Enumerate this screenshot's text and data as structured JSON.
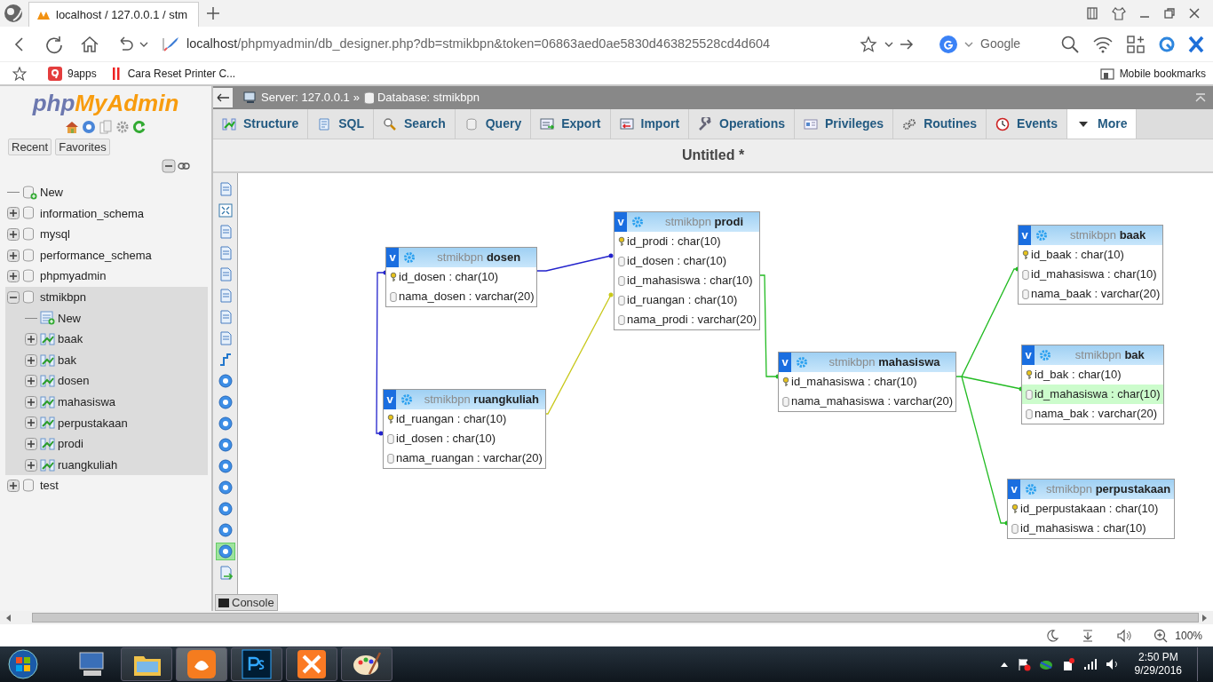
{
  "browser": {
    "tab_title": "localhost / 127.0.0.1 / stm",
    "url_host": "localhost",
    "url_path": "/phpmyadmin/db_designer.php?db=stmikbpn&token=06863aed0ae5830d463825528cd4d604",
    "search_engine": "Google",
    "bookmarks": [
      "9apps",
      "Cara Reset Printer C..."
    ],
    "mobile_bookmarks": "Mobile bookmarks"
  },
  "sidebar": {
    "logo": [
      "php",
      "MyAdmin"
    ],
    "buttons": [
      "Recent",
      "Favorites"
    ],
    "tree": [
      {
        "label": "New",
        "kind": "new"
      },
      {
        "label": "information_schema",
        "kind": "database",
        "expanded": false
      },
      {
        "label": "mysql",
        "kind": "database",
        "expanded": false
      },
      {
        "label": "performance_schema",
        "kind": "database",
        "expanded": false
      },
      {
        "label": "phpmyadmin",
        "kind": "database",
        "expanded": false
      },
      {
        "label": "stmikbpn",
        "kind": "database",
        "expanded": true,
        "children": [
          {
            "label": "New",
            "kind": "new"
          },
          {
            "label": "baak",
            "kind": "table",
            "expanded": false
          },
          {
            "label": "bak",
            "kind": "table",
            "expanded": false
          },
          {
            "label": "dosen",
            "kind": "table",
            "expanded": false
          },
          {
            "label": "mahasiswa",
            "kind": "table",
            "expanded": false
          },
          {
            "label": "perpustakaan",
            "kind": "table",
            "expanded": false
          },
          {
            "label": "prodi",
            "kind": "table",
            "expanded": false
          },
          {
            "label": "ruangkuliah",
            "kind": "table",
            "expanded": false
          }
        ]
      },
      {
        "label": "test",
        "kind": "database",
        "expanded": false
      }
    ]
  },
  "breadcrumb": {
    "server": "Server: 127.0.0.1",
    "separator": "»",
    "database": "Database: stmikbpn"
  },
  "tabs": [
    {
      "label": "Structure",
      "selected": false
    },
    {
      "label": "SQL",
      "selected": false
    },
    {
      "label": "Search",
      "selected": false
    },
    {
      "label": "Query",
      "selected": false
    },
    {
      "label": "Export",
      "selected": false
    },
    {
      "label": "Import",
      "selected": false
    },
    {
      "label": "Operations",
      "selected": false
    },
    {
      "label": "Privileges",
      "selected": false
    },
    {
      "label": "Routines",
      "selected": false
    },
    {
      "label": "Events",
      "selected": false
    },
    {
      "label": "More",
      "selected": true
    }
  ],
  "designer": {
    "title": "Untitled *",
    "console": "Console",
    "toolbar": [
      {
        "active": false
      },
      {
        "active": false
      },
      {
        "active": false
      },
      {
        "active": false
      },
      {
        "active": false
      },
      {
        "active": false
      },
      {
        "active": false
      },
      {
        "active": false
      },
      {
        "active": false
      },
      {
        "active": false
      },
      {
        "active": false
      },
      {
        "active": false
      },
      {
        "active": false
      },
      {
        "active": false
      },
      {
        "active": false
      },
      {
        "active": false
      },
      {
        "active": false
      },
      {
        "active": true
      },
      {
        "active": false
      }
    ],
    "tables": [
      {
        "toggle": "v",
        "schema": "stmikbpn",
        "name": "dosen",
        "columns": [
          {
            "text": "id_dosen : char(10)",
            "kind": "primary",
            "highlighted": false
          },
          {
            "text": "nama_dosen : varchar(20)",
            "kind": "field",
            "highlighted": false
          }
        ]
      },
      {
        "toggle": "v",
        "schema": "stmikbpn",
        "name": "prodi",
        "columns": [
          {
            "text": "id_prodi : char(10)",
            "kind": "primary",
            "highlighted": false
          },
          {
            "text": "id_dosen : char(10)",
            "kind": "field",
            "highlighted": false
          },
          {
            "text": "id_mahasiswa : char(10)",
            "kind": "field",
            "highlighted": false
          },
          {
            "text": "id_ruangan : char(10)",
            "kind": "field",
            "highlighted": false
          },
          {
            "text": "nama_prodi : varchar(20)",
            "kind": "field",
            "highlighted": false
          }
        ]
      },
      {
        "toggle": "v",
        "schema": "stmikbpn",
        "name": "ruangkuliah",
        "columns": [
          {
            "text": "id_ruangan : char(10)",
            "kind": "primary",
            "highlighted": false
          },
          {
            "text": "id_dosen : char(10)",
            "kind": "field",
            "highlighted": false
          },
          {
            "text": "nama_ruangan : varchar(20)",
            "kind": "field",
            "highlighted": false
          }
        ]
      },
      {
        "toggle": "v",
        "schema": "stmikbpn",
        "name": "mahasiswa",
        "columns": [
          {
            "text": "id_mahasiswa : char(10)",
            "kind": "primary",
            "highlighted": false
          },
          {
            "text": "nama_mahasiswa : varchar(20)",
            "kind": "field",
            "highlighted": false
          }
        ]
      },
      {
        "toggle": "v",
        "schema": "stmikbpn",
        "name": "baak",
        "columns": [
          {
            "text": "id_baak : char(10)",
            "kind": "primary",
            "highlighted": false
          },
          {
            "text": "id_mahasiswa : char(10)",
            "kind": "field",
            "highlighted": false
          },
          {
            "text": "nama_baak : varchar(20)",
            "kind": "field",
            "highlighted": false
          }
        ]
      },
      {
        "toggle": "v",
        "schema": "stmikbpn",
        "name": "bak",
        "columns": [
          {
            "text": "id_bak : char(10)",
            "kind": "primary",
            "highlighted": false
          },
          {
            "text": "id_mahasiswa : char(10)",
            "kind": "field",
            "highlighted": true
          },
          {
            "text": "nama_bak : varchar(20)",
            "kind": "field",
            "highlighted": false
          }
        ]
      },
      {
        "toggle": "v",
        "schema": "stmikbpn",
        "name": "perpustakaan",
        "columns": [
          {
            "text": "id_perpustakaan : char(10)",
            "kind": "primary",
            "highlighted": false
          },
          {
            "text": "id_mahasiswa : char(10)",
            "kind": "field",
            "highlighted": false
          }
        ]
      }
    ]
  },
  "status_bar": {
    "zoom": "100%"
  },
  "taskbar": {
    "time": "2:50 PM",
    "date": "9/29/2016"
  }
}
